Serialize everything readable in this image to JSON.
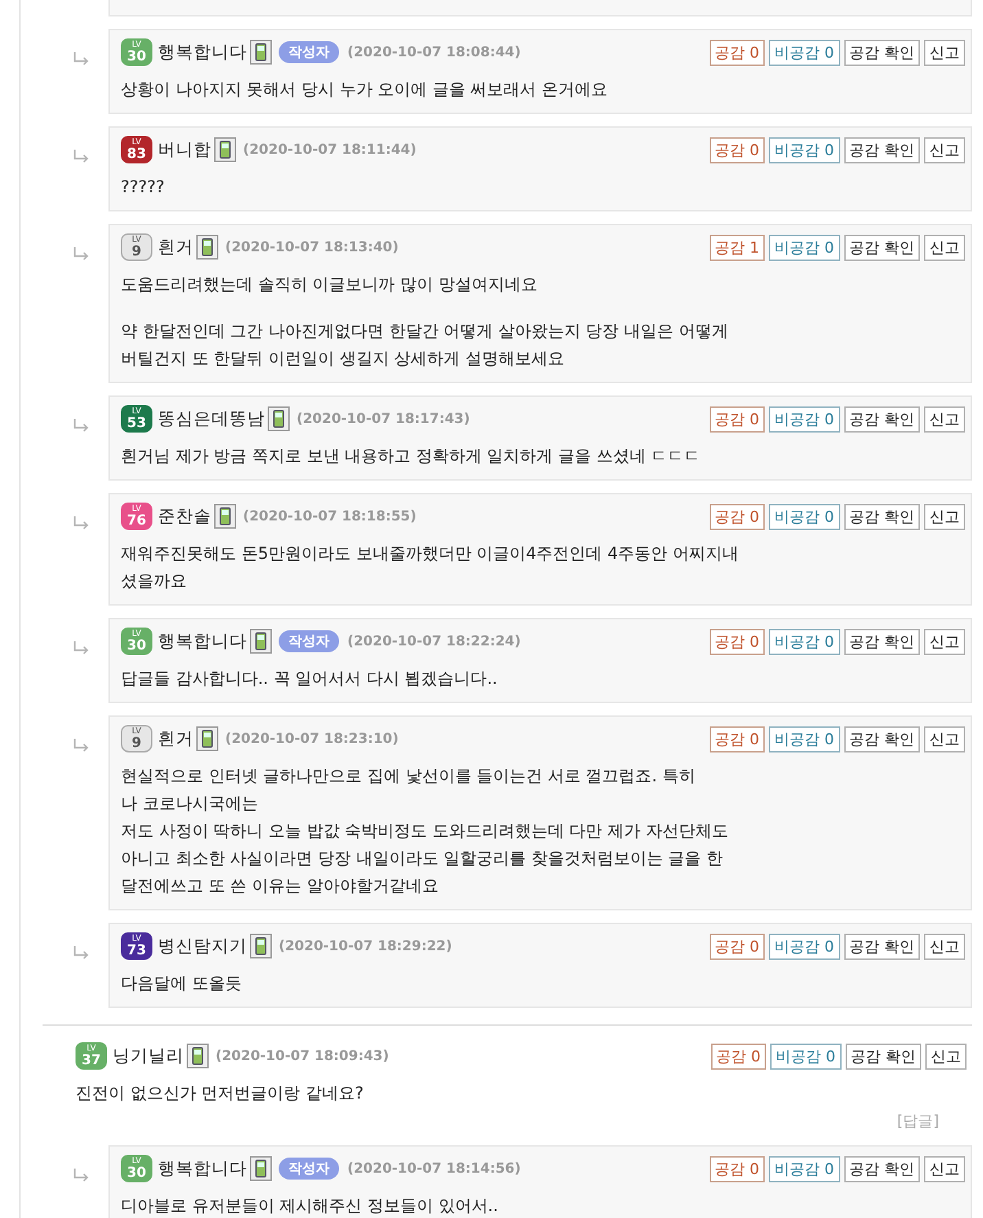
{
  "comments": [
    {
      "kind": "reply",
      "level": {
        "prefix": "LV",
        "number": "30",
        "color": "#67b067"
      },
      "author": "행복합니다",
      "author_tag": "작성자",
      "date": "(2020-10-07 18:08:44)",
      "buttons": {
        "like": "공감 0",
        "dislike": "비공감 0",
        "check": "공감 확인",
        "report": "신고"
      },
      "paragraphs": [
        [
          "상황이 나아지지 못해서 당시 누가 오이에 글을 써보래서 온거에요"
        ]
      ]
    },
    {
      "kind": "reply",
      "level": {
        "prefix": "LV",
        "number": "83",
        "color": "#b3262b"
      },
      "author": "버니합",
      "date": "(2020-10-07 18:11:44)",
      "buttons": {
        "like": "공감 0",
        "dislike": "비공감 0",
        "check": "공감 확인",
        "report": "신고"
      },
      "paragraphs": [
        [
          "?????"
        ]
      ]
    },
    {
      "kind": "reply",
      "level": {
        "prefix": "LV",
        "number": "9",
        "color": "#e6e6e6"
      },
      "author": "흰거",
      "date": "(2020-10-07 18:13:40)",
      "buttons": {
        "like": "공감 1",
        "dislike": "비공감 0",
        "check": "공감 확인",
        "report": "신고"
      },
      "paragraphs": [
        [
          "도움드리려했는데 솔직히 이글보니까 많이 망설여지네요"
        ],
        [
          "약 한달전인데 그간 나아진게없다면 한달간 어떻게 살아왔는지 당장 내일은 어떻게",
          "버틸건지 또 한달뒤 이런일이 생길지 상세하게 설명해보세요"
        ]
      ]
    },
    {
      "kind": "reply",
      "level": {
        "prefix": "LV",
        "number": "53",
        "color": "#1d7a4c"
      },
      "author": "똥심은데똥남",
      "date": "(2020-10-07 18:17:43)",
      "buttons": {
        "like": "공감 0",
        "dislike": "비공감 0",
        "check": "공감 확인",
        "report": "신고"
      },
      "paragraphs": [
        [
          "흰거님 제가 방금 쪽지로 보낸 내용하고 정확하게 일치하게 글을 쓰셨네 ㄷㄷㄷ"
        ]
      ]
    },
    {
      "kind": "reply",
      "level": {
        "prefix": "LV",
        "number": "76",
        "color": "#e8508a"
      },
      "author": "준찬솔",
      "date": "(2020-10-07 18:18:55)",
      "buttons": {
        "like": "공감 0",
        "dislike": "비공감 0",
        "check": "공감 확인",
        "report": "신고"
      },
      "paragraphs": [
        [
          "재워주진못해도 돈5만원이라도 보내줄까했더만 이글이4주전인데 4주동안 어찌지내",
          "셨을까요"
        ]
      ]
    },
    {
      "kind": "reply",
      "level": {
        "prefix": "LV",
        "number": "30",
        "color": "#67b067"
      },
      "author": "행복합니다",
      "author_tag": "작성자",
      "date": "(2020-10-07 18:22:24)",
      "buttons": {
        "like": "공감 0",
        "dislike": "비공감 0",
        "check": "공감 확인",
        "report": "신고"
      },
      "paragraphs": [
        [
          "답글들 감사합니다.. 꼭 일어서서 다시 뵙겠습니다.."
        ]
      ]
    },
    {
      "kind": "reply",
      "level": {
        "prefix": "LV",
        "number": "9",
        "color": "#e6e6e6"
      },
      "author": "흰거",
      "date": "(2020-10-07 18:23:10)",
      "buttons": {
        "like": "공감 0",
        "dislike": "비공감 0",
        "check": "공감 확인",
        "report": "신고"
      },
      "paragraphs": [
        [
          "현실적으로 인터넷 글하나만으로 집에 낯선이를 들이는건 서로 껄끄럽죠. 특히",
          "나 코로나시국에는",
          "저도 사정이 딱하니 오늘 밥값 숙박비정도 도와드리려했는데 다만 제가 자선단체도",
          "아니고 최소한 사실이라면 당장 내일이라도 일할궁리를 찾을것처럼보이는 글을 한",
          "달전에쓰고 또 쓴 이유는 알아야할거같네요"
        ]
      ]
    },
    {
      "kind": "reply",
      "level": {
        "prefix": "LV",
        "number": "73",
        "color": "#4a2c9c"
      },
      "author": "병신탐지기",
      "date": "(2020-10-07 18:29:22)",
      "buttons": {
        "like": "공감 0",
        "dislike": "비공감 0",
        "check": "공감 확인",
        "report": "신고"
      },
      "paragraphs": [
        [
          "다음달에 또올듯"
        ]
      ]
    },
    {
      "kind": "top",
      "level": {
        "prefix": "LV",
        "number": "37",
        "color": "#67b067"
      },
      "author": "닝기닐리",
      "date": "(2020-10-07 18:09:43)",
      "buttons": {
        "like": "공감 0",
        "dislike": "비공감 0",
        "check": "공감 확인",
        "report": "신고"
      },
      "paragraphs": [
        [
          "진전이 없으신가 먼저번글이랑 같네요?"
        ]
      ],
      "reply_link": "[답글]"
    },
    {
      "kind": "reply",
      "level": {
        "prefix": "LV",
        "number": "30",
        "color": "#67b067"
      },
      "author": "행복합니다",
      "author_tag": "작성자",
      "date": "(2020-10-07 18:14:56)",
      "buttons": {
        "like": "공감 0",
        "dislike": "비공감 0",
        "check": "공감 확인",
        "report": "신고"
      },
      "paragraphs": [
        [
          "디아블로 유저분들이 제시해주신 정보들이 있어서.."
        ]
      ]
    }
  ]
}
